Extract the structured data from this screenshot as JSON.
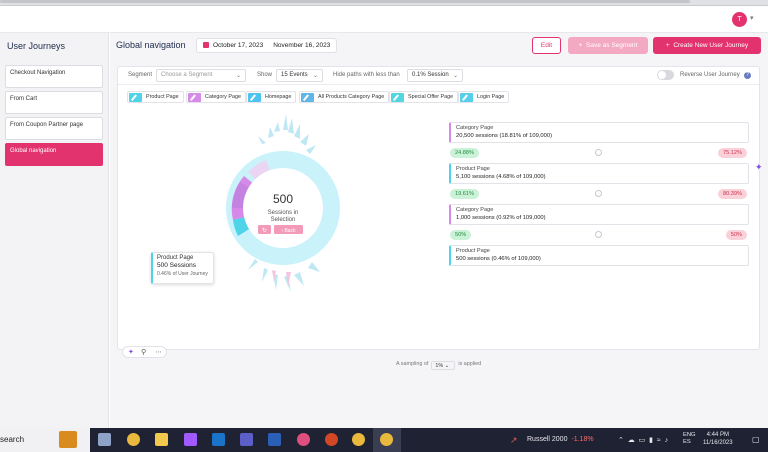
{
  "header": {
    "avatar_initial": "T"
  },
  "sidebar": {
    "title": "User Journeys",
    "items": [
      {
        "label": "Checkout Navigation"
      },
      {
        "label": "From Cart"
      },
      {
        "label": "From Coupon Partner page"
      },
      {
        "label": "Global navigation"
      }
    ]
  },
  "main": {
    "title": "Global navigation",
    "date_start": "October 17, 2023",
    "date_end": "November 16, 2023",
    "edit_label": "Edit",
    "save_segment_label": "Save as Segment",
    "create_label": "Create New User Journey"
  },
  "filters": {
    "segment_label": "Segment",
    "segment_placeholder": "Choose a Segment",
    "show_label": "Show",
    "show_value": "15 Events",
    "hide_label": "Hide paths with less than",
    "hide_value": "0.1% Session",
    "reverse_label": "Reverse User Journey"
  },
  "chips": [
    {
      "label": "Product Page",
      "color": "#4fd3e8"
    },
    {
      "label": "Category Page",
      "color": "#d58ae8"
    },
    {
      "label": "Homepage",
      "color": "#4fc3f0"
    },
    {
      "label": "All Products Category Page",
      "color": "#60b6e6"
    },
    {
      "label": "Special Offer Page",
      "color": "#52d6e0"
    },
    {
      "label": "Login Page",
      "color": "#56d0ea"
    }
  ],
  "center": {
    "value": "500",
    "label_line1": "Sessions in",
    "label_line2": "Selection",
    "back_label": "Back"
  },
  "tooltip": {
    "title": "Product Page",
    "sessions": "500 Sessions",
    "share": "0.46% of User Journey"
  },
  "flow": [
    {
      "name": "Category Page",
      "detail": "20,500 sessions (18.81% of 109,000)",
      "color": "#d58ae8"
    },
    {
      "left_pct": "24.88%",
      "right_pct": "75.12%"
    },
    {
      "name": "Product Page",
      "detail": "5,100 sessions (4.68% of 109,000)",
      "color": "#4fd3e8"
    },
    {
      "left_pct": "19.61%",
      "right_pct": "80.39%"
    },
    {
      "name": "Category Page",
      "detail": "1,000 sessions (0.92% of 109,000)",
      "color": "#d58ae8"
    },
    {
      "left_pct": "50%",
      "right_pct": "50%"
    },
    {
      "name": "Product Page",
      "detail": "500 sessions (0.46% of 109,000)",
      "color": "#4fd3e8"
    }
  ],
  "sampling": {
    "prefix": "A sampling of",
    "value": "1%",
    "suffix": "is applied"
  },
  "taskbar": {
    "search_label": "search",
    "ticker_name": "Russell 2000",
    "ticker_change": "-1.18%",
    "lang_line1": "ENG",
    "lang_line2": "ES",
    "time": "4:44 PM",
    "date": "11/16/2023"
  },
  "colors": {
    "accent": "#e2336e",
    "accent_light": "#f4a9c2",
    "cyan": "#4fd3e8",
    "purple": "#d58ae8"
  }
}
